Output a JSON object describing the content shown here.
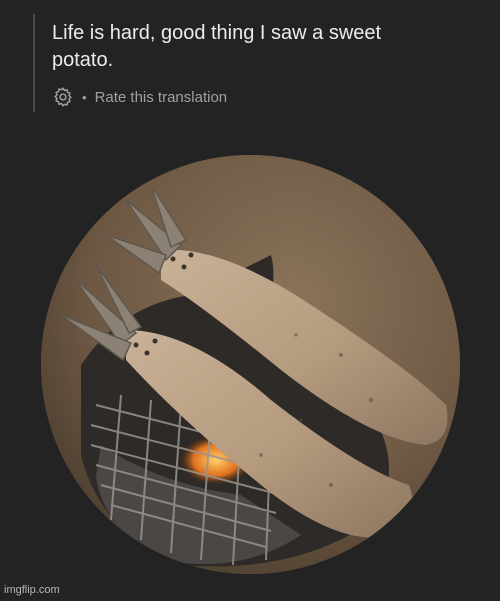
{
  "translation": {
    "text": "Life is hard, good thing I saw a sweet\npotato.",
    "rate_label": "Rate this translation",
    "separator": "•",
    "settings_icon": "gear-icon"
  },
  "image": {
    "description_icon": "photo",
    "shape": "circle"
  },
  "watermark": {
    "text": "imgflip.com"
  },
  "colors": {
    "background": "#232324",
    "text_primary": "#ececec",
    "text_secondary": "#a0a0a3"
  }
}
